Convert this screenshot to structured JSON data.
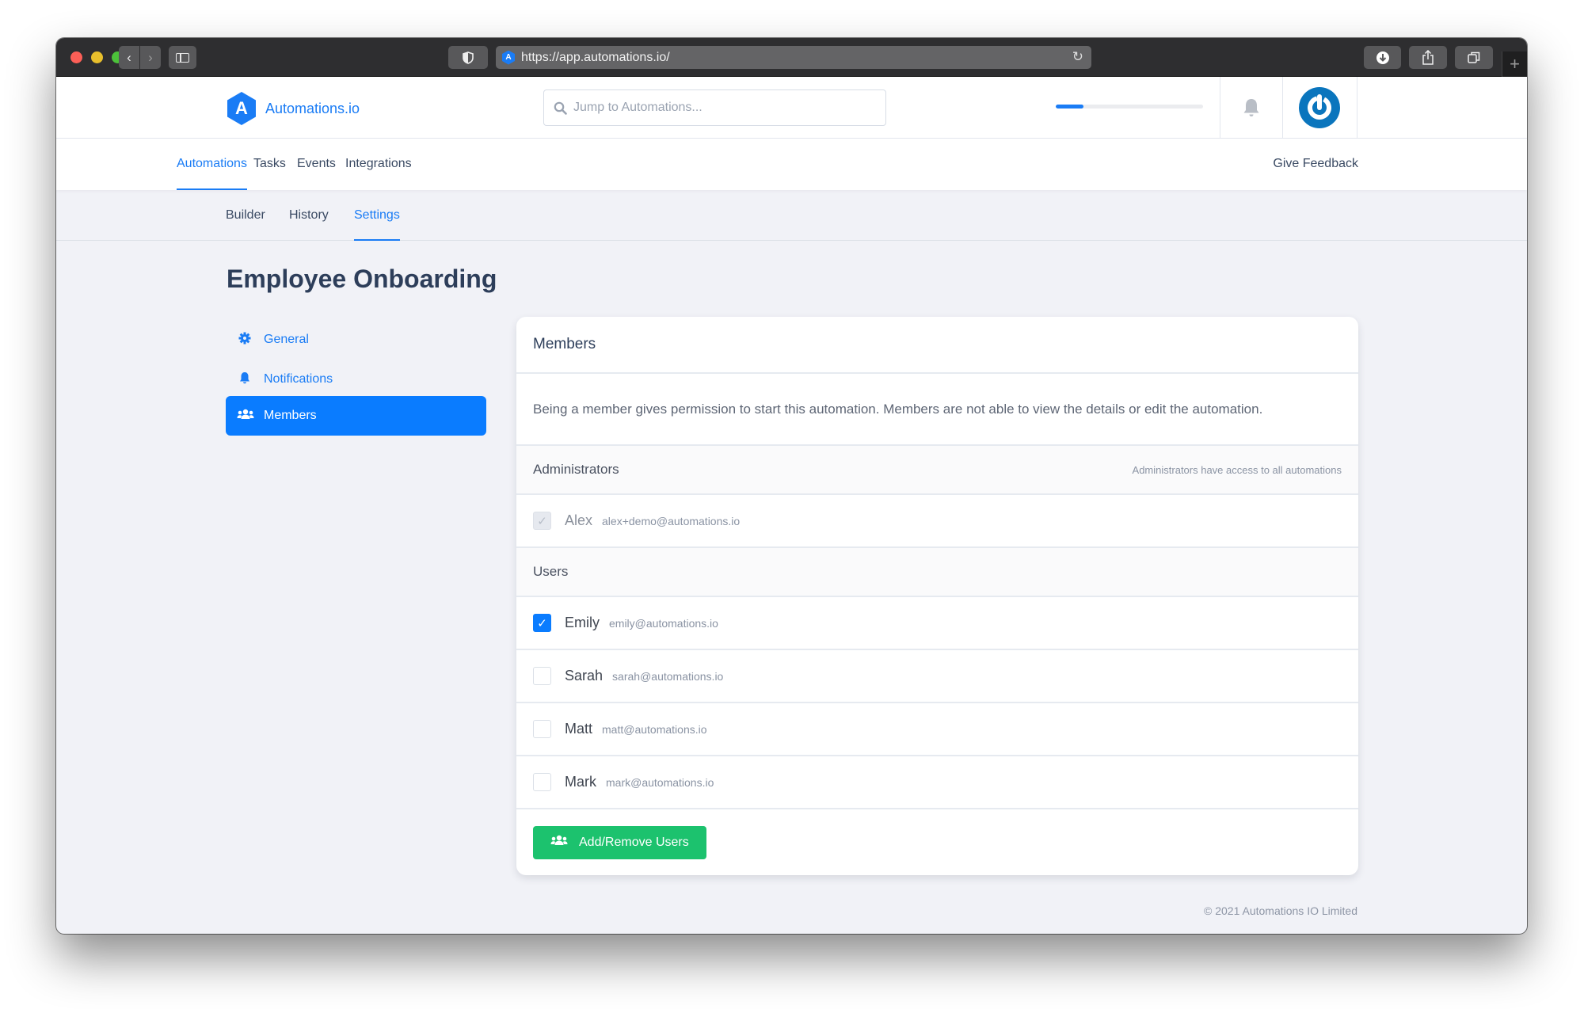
{
  "browser": {
    "url": "https://app.automations.io/",
    "favicon_letter": "A",
    "new_tab_label": "+"
  },
  "header": {
    "logo_letter": "A",
    "brand": "Automations.io",
    "search_placeholder": "Jump to Automations...",
    "progress_percent": 19,
    "accent_color": "#1a7cf5"
  },
  "nav": {
    "items": [
      {
        "label": "Automations",
        "active": true
      },
      {
        "label": "Tasks",
        "active": false
      },
      {
        "label": "Events",
        "active": false
      },
      {
        "label": "Integrations",
        "active": false
      }
    ],
    "feedback": "Give Feedback"
  },
  "subnav": {
    "items": [
      {
        "label": "Builder",
        "active": false
      },
      {
        "label": "History",
        "active": false
      },
      {
        "label": "Settings",
        "active": true
      }
    ]
  },
  "page_title": "Employee Onboarding",
  "side_menu": [
    {
      "label": "General",
      "icon": "gear-icon",
      "active": false
    },
    {
      "label": "Notifications",
      "icon": "bell-icon",
      "active": false
    },
    {
      "label": "Members",
      "icon": "users-icon",
      "active": true
    }
  ],
  "card": {
    "title": "Members",
    "description": "Being a member gives permission to start this automation. Members are not able to view the details or edit the automation.",
    "admins": {
      "heading": "Administrators",
      "note": "Administrators have access to all automations",
      "members": [
        {
          "name": "Alex",
          "email": "alex+demo@automations.io",
          "checked": true,
          "disabled": true
        }
      ]
    },
    "users": {
      "heading": "Users",
      "members": [
        {
          "name": "Emily",
          "email": "emily@automations.io",
          "checked": true
        },
        {
          "name": "Sarah",
          "email": "sarah@automations.io",
          "checked": false
        },
        {
          "name": "Matt",
          "email": "matt@automations.io",
          "checked": false
        },
        {
          "name": "Mark",
          "email": "mark@automations.io",
          "checked": false
        }
      ]
    },
    "add_button": "Add/Remove Users",
    "button_color": "#1cc26e"
  },
  "footer": "© 2021 Automations IO Limited"
}
